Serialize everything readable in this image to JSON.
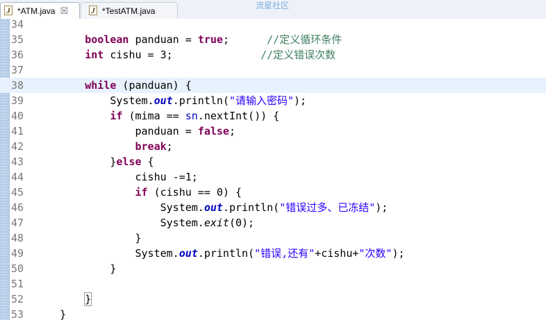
{
  "tabs": [
    {
      "label": "*ATM.java",
      "active": true,
      "close": "☒"
    },
    {
      "label": "*TestATM.java",
      "active": false
    }
  ],
  "watermark": "流星社区",
  "lines": [
    {
      "num": "34",
      "code": []
    },
    {
      "num": "35",
      "code": [
        [
          "i",
          "        "
        ],
        [
          "kw",
          "boolean"
        ],
        [
          "t",
          " panduan = "
        ],
        [
          "kw",
          "true"
        ],
        [
          "t",
          ";      "
        ],
        [
          "cmt",
          "//定义循环条件"
        ]
      ]
    },
    {
      "num": "36",
      "code": [
        [
          "i",
          "        "
        ],
        [
          "kw",
          "int"
        ],
        [
          "t",
          " cishu = 3;              "
        ],
        [
          "cmt",
          "//定义错误次数"
        ]
      ]
    },
    {
      "num": "37",
      "code": []
    },
    {
      "num": "38",
      "current": true,
      "code": [
        [
          "i",
          "        "
        ],
        [
          "kw",
          "while"
        ],
        [
          "t",
          " (panduan) {"
        ]
      ]
    },
    {
      "num": "39",
      "code": [
        [
          "i",
          "            "
        ],
        [
          "t",
          "System."
        ],
        [
          "sfld",
          "out"
        ],
        [
          "t",
          ".println("
        ],
        [
          "str",
          "\"请输入密码\""
        ],
        [
          "t",
          ");"
        ]
      ]
    },
    {
      "num": "40",
      "code": [
        [
          "i",
          "            "
        ],
        [
          "kw",
          "if"
        ],
        [
          "t",
          " (mima == "
        ],
        [
          "fld",
          "sn"
        ],
        [
          "t",
          ".nextInt()) {"
        ]
      ]
    },
    {
      "num": "41",
      "code": [
        [
          "i",
          "                "
        ],
        [
          "t",
          "panduan = "
        ],
        [
          "kw",
          "false"
        ],
        [
          "t",
          ";"
        ]
      ]
    },
    {
      "num": "42",
      "code": [
        [
          "i",
          "                "
        ],
        [
          "kw",
          "break"
        ],
        [
          "t",
          ";"
        ]
      ]
    },
    {
      "num": "43",
      "code": [
        [
          "i",
          "            "
        ],
        [
          "t",
          "}"
        ],
        [
          "kw",
          "else"
        ],
        [
          "t",
          " {"
        ]
      ]
    },
    {
      "num": "44",
      "code": [
        [
          "i",
          "                "
        ],
        [
          "t",
          "cishu -=1;"
        ]
      ]
    },
    {
      "num": "45",
      "code": [
        [
          "i",
          "                "
        ],
        [
          "kw",
          "if"
        ],
        [
          "t",
          " (cishu == 0) {"
        ]
      ]
    },
    {
      "num": "46",
      "code": [
        [
          "i",
          "                    "
        ],
        [
          "t",
          "System."
        ],
        [
          "sfld",
          "out"
        ],
        [
          "t",
          ".println("
        ],
        [
          "str",
          "\"错误过多、已冻结\""
        ],
        [
          "t",
          ");"
        ]
      ]
    },
    {
      "num": "47",
      "code": [
        [
          "i",
          "                    "
        ],
        [
          "t",
          "System."
        ],
        [
          "smeth",
          "exit"
        ],
        [
          "t",
          "(0);"
        ]
      ]
    },
    {
      "num": "48",
      "code": [
        [
          "i",
          "                "
        ],
        [
          "t",
          "}"
        ]
      ]
    },
    {
      "num": "49",
      "code": [
        [
          "i",
          "                "
        ],
        [
          "t",
          "System."
        ],
        [
          "sfld",
          "out"
        ],
        [
          "t",
          ".println("
        ],
        [
          "str",
          "\"错误,还有\""
        ],
        [
          "t",
          "+cishu+"
        ],
        [
          "str",
          "\"次数\""
        ],
        [
          "t",
          ");"
        ]
      ]
    },
    {
      "num": "50",
      "code": [
        [
          "i",
          "            "
        ],
        [
          "t",
          "}"
        ]
      ]
    },
    {
      "num": "51",
      "code": []
    },
    {
      "num": "52",
      "code": [
        [
          "i",
          "        "
        ],
        [
          "box",
          "}"
        ]
      ]
    },
    {
      "num": "53",
      "code": [
        [
          "i",
          "    "
        ],
        [
          "t",
          "}"
        ]
      ]
    }
  ]
}
